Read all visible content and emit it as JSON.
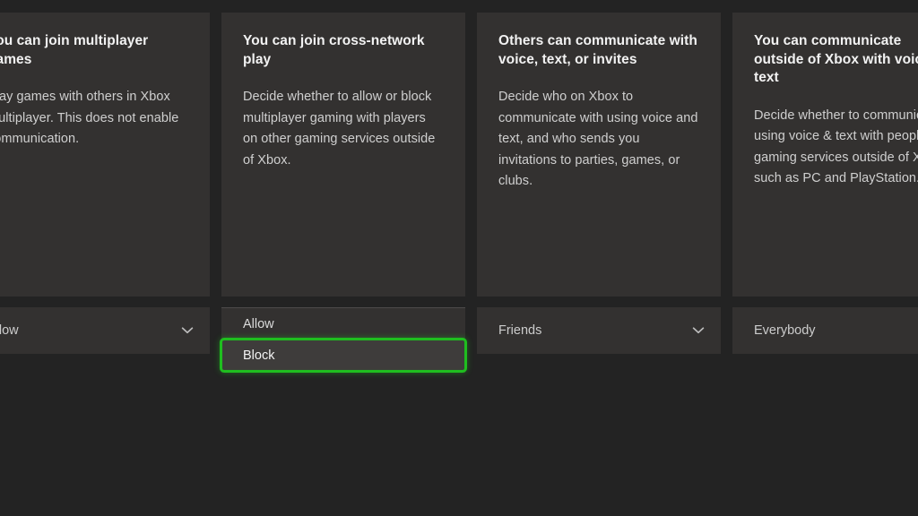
{
  "colors": {
    "page_background": "#232323",
    "card_background": "#333130",
    "selected_option_background": "#3e3c3b",
    "focus_ring_green": "#1fbe1f",
    "title_text": "#f2f2f2",
    "body_text": "#cfcfcf"
  },
  "settings": [
    {
      "title": "You can join multiplayer games",
      "description": "Play games with others in Xbox multiplayer. This does not enable communication.",
      "control": {
        "type": "dropdown-closed",
        "value": "Allow",
        "icon": "chevron-down-icon"
      }
    },
    {
      "title": "You can join cross-network play",
      "description": "Decide whether to allow or block multiplayer gaming with players on other gaming services outside of Xbox.",
      "control": {
        "type": "dropdown-open",
        "options": [
          {
            "label": "Allow",
            "selected": false
          },
          {
            "label": "Block",
            "selected": true
          }
        ]
      }
    },
    {
      "title": "Others can communicate with voice, text, or invites",
      "description": "Decide who on Xbox to communicate with using voice and text, and who sends you invitations to parties, games, or clubs.",
      "control": {
        "type": "dropdown-closed",
        "value": "Friends",
        "icon": "chevron-down-icon"
      }
    },
    {
      "title": "You can communicate outside of Xbox with voice & text",
      "description": "Decide whether to communicate using voice & text with people on gaming services outside of Xbox, such as PC and PlayStation.",
      "control": {
        "type": "dropdown-closed",
        "value": "Everybody",
        "icon": "chevron-down-icon"
      }
    }
  ]
}
